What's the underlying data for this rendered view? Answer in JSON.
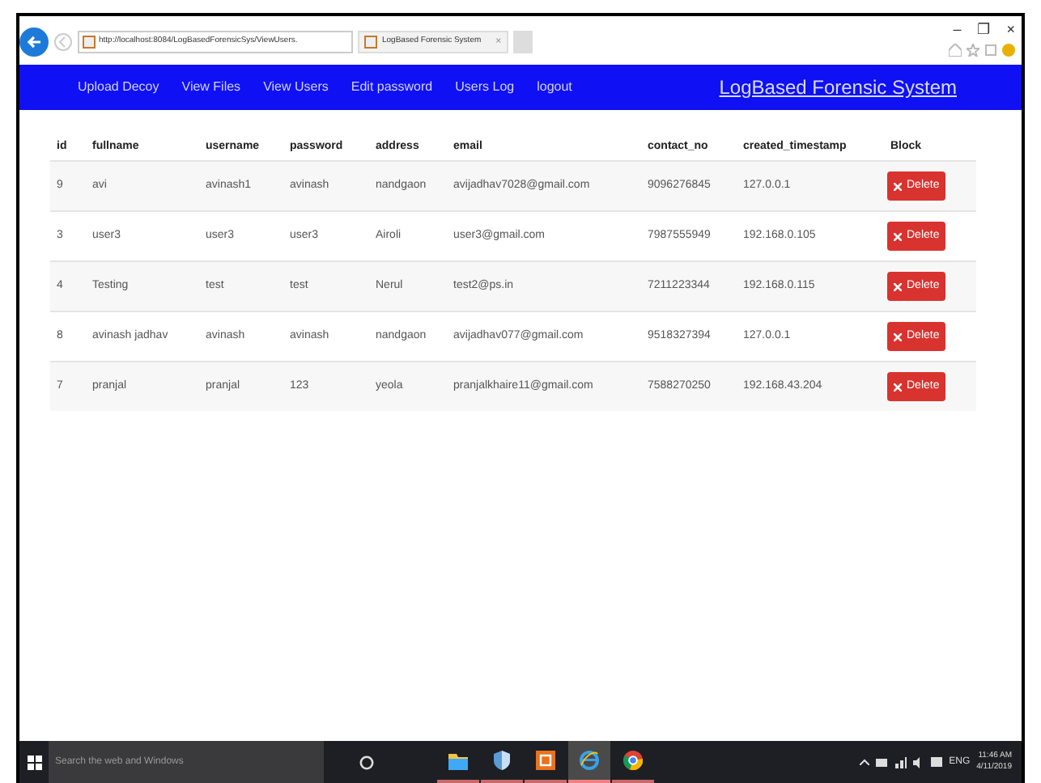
{
  "browser": {
    "address": "http://localhost:8084/LogBasedForensicSys/ViewUsers.",
    "tab_title": "LogBased Forensic System",
    "window_controls": [
      "–",
      "❐",
      "×"
    ]
  },
  "navbar": {
    "items": [
      "Upload Decoy",
      "View Files",
      "View Users",
      "Edit password",
      "Users Log",
      "logout"
    ],
    "brand": "LogBased Forensic System"
  },
  "table": {
    "columns": [
      "id",
      "fullname",
      "username",
      "password",
      "address",
      "email",
      "contact_no",
      "created_timestamp",
      "Block"
    ],
    "rows": [
      {
        "cells": [
          "9",
          "avi",
          "avinash1",
          "avinash",
          "nandgaon",
          "avijadhav7028@gmail.com",
          "9096276845",
          "127.0.0.1"
        ],
        "action": "Delete"
      },
      {
        "cells": [
          "3",
          "user3",
          "user3",
          "user3",
          "Airoli",
          "user3@gmail.com",
          "7987555949",
          "192.168.0.105"
        ],
        "action": "Delete"
      },
      {
        "cells": [
          "4",
          "Testing",
          "test",
          "test",
          "Nerul",
          "test2@ps.in",
          "7211223344",
          "192.168.0.115"
        ],
        "action": "Delete"
      },
      {
        "cells": [
          "8",
          "avinash jadhav",
          "avinash",
          "avinash",
          "nandgaon",
          "avijadhav077@gmail.com",
          "9518327394",
          "127.0.0.1"
        ],
        "action": "Delete"
      },
      {
        "cells": [
          "7",
          "pranjal",
          "pranjal",
          "123",
          "yeola",
          "pranjalkhaire11@gmail.com",
          "7588270250",
          "192.168.43.204"
        ],
        "action": "Delete"
      }
    ]
  },
  "taskbar": {
    "search_placeholder": "Search the web and Windows",
    "apps": [
      {
        "kind": "folder",
        "selected": false
      },
      {
        "kind": "shield",
        "selected": false
      },
      {
        "kind": "office",
        "selected": false
      },
      {
        "kind": "ie",
        "selected": true
      },
      {
        "kind": "chrome",
        "selected": false
      }
    ],
    "language": "ENG",
    "time": "11:46 AM",
    "date": "4/11/2019"
  }
}
